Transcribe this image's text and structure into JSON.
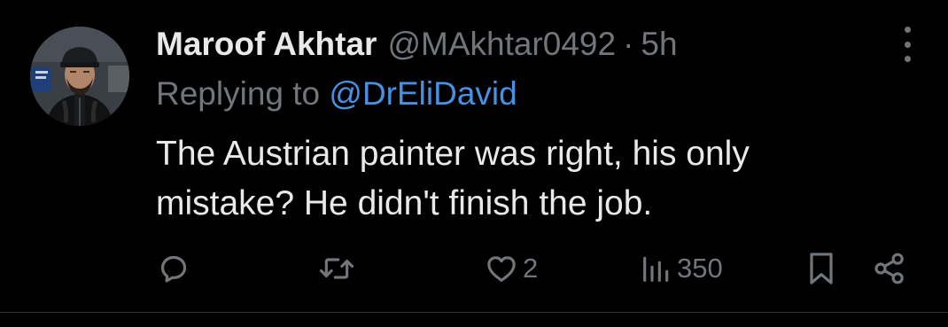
{
  "tweet": {
    "display_name": "Maroof Akhtar",
    "handle": "@MAkhtar0492",
    "separator": "·",
    "time": "5h",
    "replying_prefix": "Replying to",
    "replying_to": "@DrEliDavid",
    "line1": "The Austrian painter was right, his only",
    "line2": "mistake? He didn't finish the job."
  },
  "actions": {
    "reply_icon": "speech-bubble-icon",
    "retweet_icon": "retweet-icon",
    "like_icon": "heart-icon",
    "like_count": "2",
    "views_icon": "bar-chart-icon",
    "views_count": "350",
    "bookmark_icon": "bookmark-icon",
    "share_icon": "share-icon"
  },
  "colors": {
    "background": "#000000",
    "primary_text": "#e7e9ea",
    "secondary_text": "#71767b",
    "mention": "#4a90e2",
    "divider": "#2f3336"
  }
}
